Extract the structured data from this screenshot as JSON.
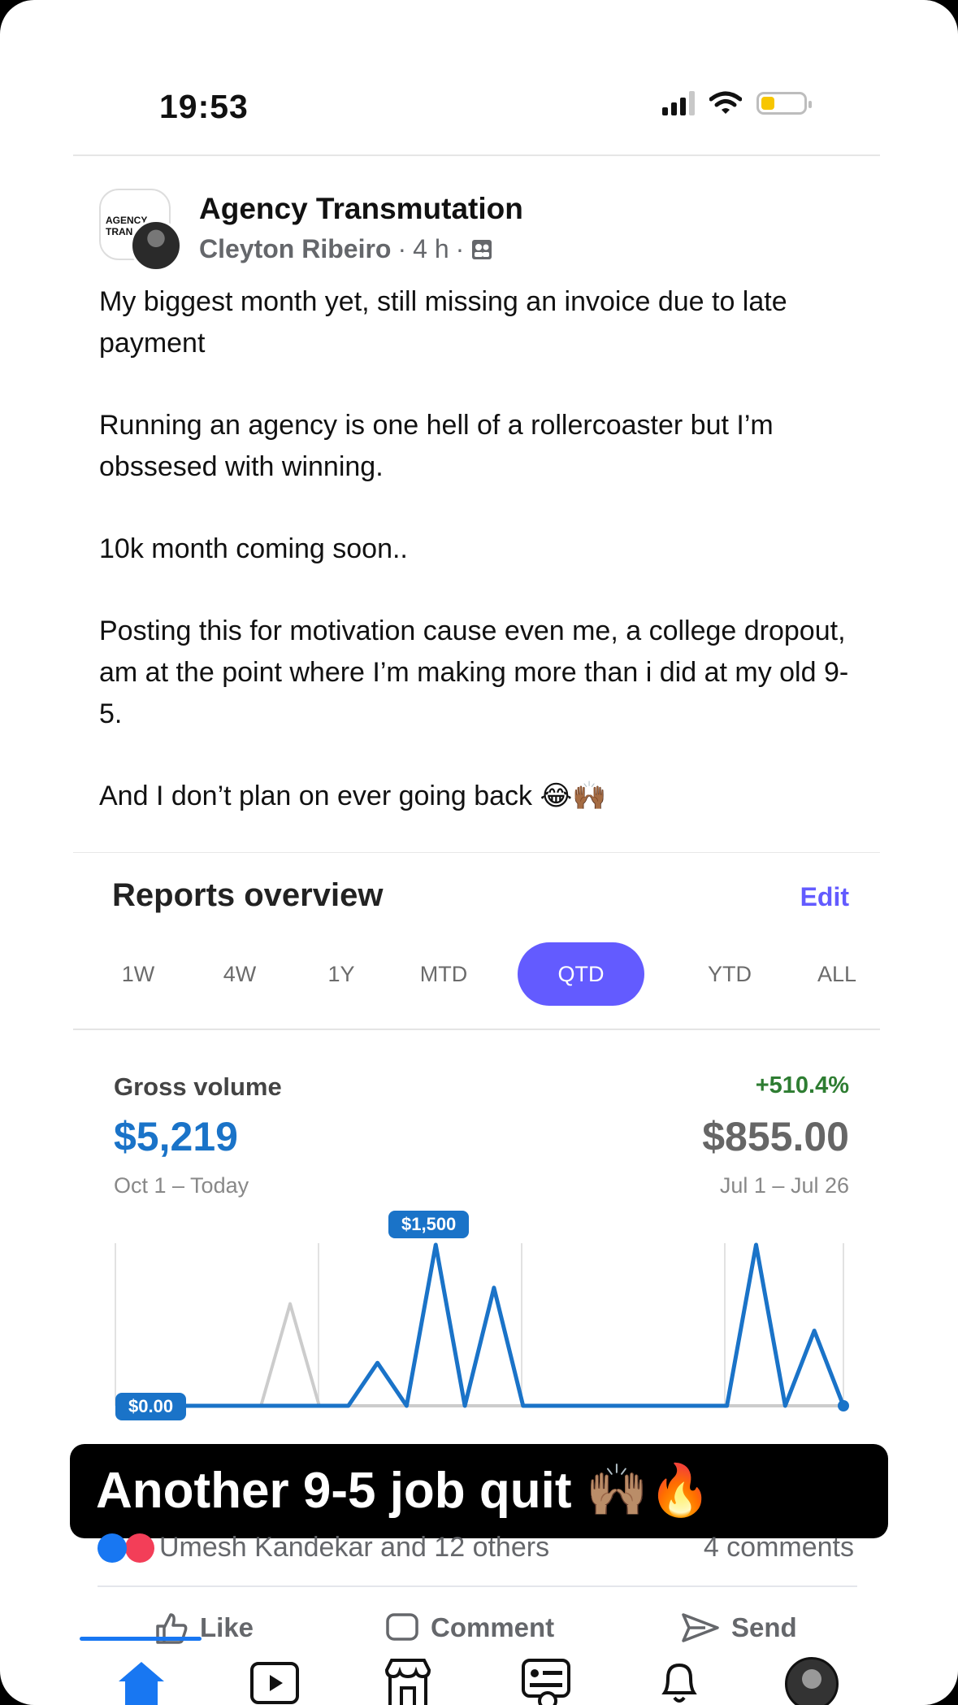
{
  "status_bar": {
    "time": "19:53"
  },
  "post": {
    "group_name": "Agency Transmutation",
    "group_avatar_text": "AGENCY TRAN",
    "author": "Cleyton Ribeiro",
    "time_ago": "4 h",
    "separator": "·",
    "paragraphs": [
      "My biggest month yet, still missing an invoice due to late payment",
      "Running an agency is one hell of a rollercoaster but I’m obssesed with winning.",
      "10k month coming soon..",
      "Posting this for motivation cause even me, a college dropout, am at the point where I’m making more than i did at my old 9-5.",
      "And I don’t plan on ever going back 😂🙌🏾"
    ]
  },
  "report": {
    "title": "Reports overview",
    "edit_label": "Edit",
    "tabs": [
      "1W",
      "4W",
      "1Y",
      "MTD",
      "QTD",
      "YTD",
      "ALL"
    ],
    "active_tab": "QTD",
    "gross_volume_label": "Gross volume",
    "change_pct": "+510.4%",
    "current_value": "$5,219",
    "previous_value": "$855.00",
    "current_range": "Oct 1 – Today",
    "previous_range": "Jul 1 – Jul 26",
    "peak_label": "$1,500",
    "zero_label": "$0.00",
    "colors": {
      "accent": "#635bff",
      "series_current": "#1a73c8",
      "series_previous": "#cccccc",
      "positive": "#2e7d32"
    }
  },
  "chart_data": {
    "type": "line",
    "ylim": [
      0,
      1500
    ],
    "series": [
      {
        "x": [
          0,
          1,
          2,
          3,
          4,
          5,
          6,
          7,
          8,
          9,
          10,
          11,
          12,
          13,
          14,
          15,
          16,
          17,
          18,
          19,
          20,
          21,
          22,
          23,
          24,
          25
        ],
        "values": [
          0,
          0,
          0,
          0,
          0,
          0,
          0,
          0,
          0,
          400,
          0,
          1500,
          0,
          1100,
          0,
          0,
          0,
          0,
          0,
          0,
          0,
          0,
          1500,
          0,
          700,
          0
        ]
      },
      {
        "x": [
          0,
          1,
          2,
          3,
          4,
          5,
          6,
          7,
          8,
          9,
          10,
          11,
          12,
          13,
          14,
          15,
          16,
          17,
          18,
          19,
          20,
          21,
          22,
          23,
          24,
          25
        ],
        "values": [
          0,
          0,
          0,
          0,
          0,
          0,
          950,
          0,
          0,
          0,
          0,
          0,
          0,
          0,
          0,
          0,
          0,
          0,
          0,
          0,
          0,
          0,
          0,
          0,
          0,
          0
        ]
      }
    ]
  },
  "caption": "Another 9-5 job quit 🙌🏽🔥",
  "engagement": {
    "reactions_text": "Umesh Kandekar and 12 others",
    "comments_text": "4 comments",
    "like_label": "Like",
    "comment_label": "Comment",
    "send_label": "Send"
  },
  "nav_icons": [
    "home-icon",
    "video-icon",
    "marketplace-icon",
    "feeds-icon",
    "bell-icon",
    "profile-avatar"
  ]
}
